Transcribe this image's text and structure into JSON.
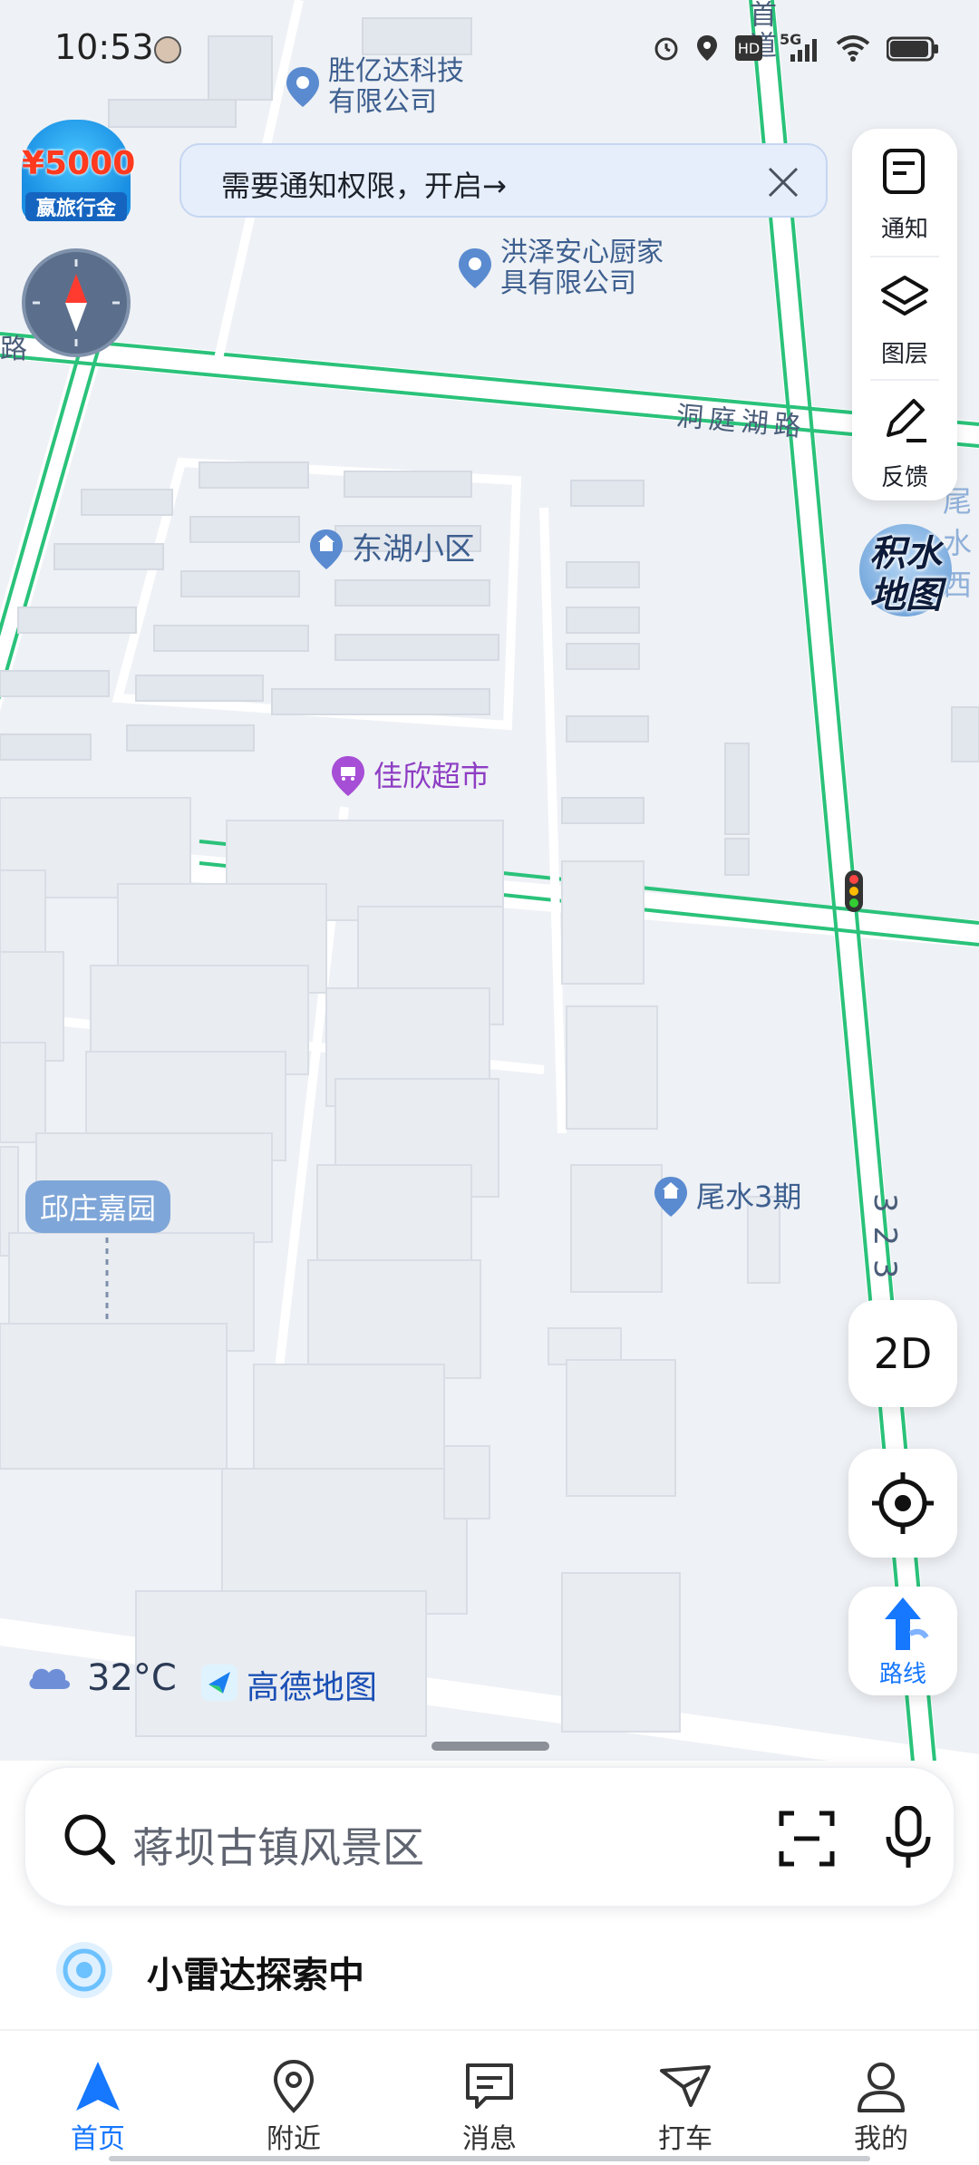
{
  "status_bar": {
    "time": "10:53",
    "network": "5G"
  },
  "promo": {
    "amount": "¥5000",
    "subtitle": "嬴旅行金"
  },
  "notice": {
    "text": "需要通知权限，开启→"
  },
  "sidebar": {
    "items": [
      {
        "label": "通知",
        "icon": "notice-icon"
      },
      {
        "label": "图层",
        "icon": "layers-icon"
      },
      {
        "label": "反馈",
        "icon": "feedback-icon"
      }
    ]
  },
  "flood_map": {
    "line1": "积水",
    "line2": "地图"
  },
  "map": {
    "pois": [
      {
        "name": "胜亿达科技\n有限公司",
        "type": "company"
      },
      {
        "name": "洪泽安心厨家\n具有限公司",
        "type": "company"
      },
      {
        "name": "东湖小区",
        "type": "residence"
      },
      {
        "name": "佳欣超市",
        "type": "shop"
      },
      {
        "name": "尾水3期",
        "type": "residence"
      },
      {
        "name": "邱庄嘉园",
        "type": "area"
      }
    ],
    "roads": {
      "dongting": "洞庭湖路",
      "left_edge": "路",
      "top_vertical": "首道",
      "right_vertical": "3 2 3",
      "right_edge": "尾水 西"
    }
  },
  "mode_button": {
    "label": "2D"
  },
  "route_button": {
    "label": "路线"
  },
  "weather": {
    "temperature": "32°C"
  },
  "brand": {
    "name": "高德地图"
  },
  "search": {
    "placeholder": "蒋坝古镇风景区"
  },
  "radar": {
    "text": "小雷达探索中"
  },
  "tabs": [
    {
      "label": "首页",
      "active": true
    },
    {
      "label": "附近",
      "active": false
    },
    {
      "label": "消息",
      "active": false
    },
    {
      "label": "打车",
      "active": false
    },
    {
      "label": "我的",
      "active": false
    }
  ],
  "colors": {
    "accent": "#1677ff",
    "road": "#2ac27a",
    "building": "#e9ecf1"
  }
}
